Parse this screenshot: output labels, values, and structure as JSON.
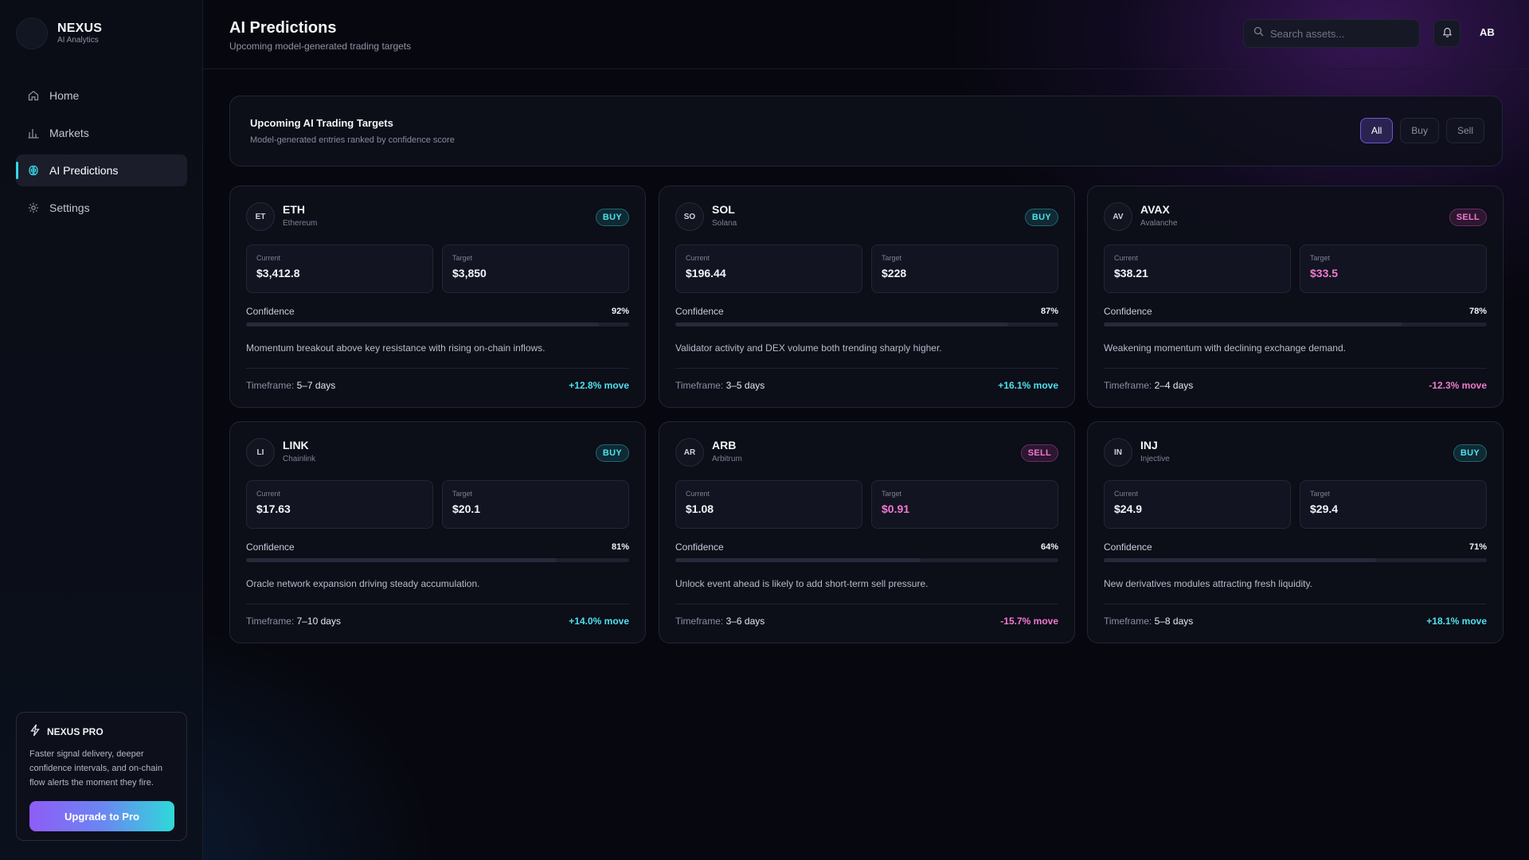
{
  "brand": {
    "name": "NEXUS",
    "subtitle": "AI Analytics"
  },
  "nav": {
    "items": [
      {
        "label": "Home",
        "icon": "home-icon",
        "active": false
      },
      {
        "label": "Markets",
        "icon": "bar-chart-icon",
        "active": false
      },
      {
        "label": "AI Predictions",
        "icon": "brain-icon",
        "active": true
      },
      {
        "label": "Settings",
        "icon": "gear-icon",
        "active": false
      }
    ]
  },
  "pro": {
    "title": "NEXUS PRO",
    "icon": "lightning-icon",
    "description": "Faster signal delivery, deeper confidence intervals, and on-chain flow alerts the moment they fire.",
    "button": "Upgrade to Pro"
  },
  "header": {
    "title": "AI Predictions",
    "subtitle": "Upcoming model-generated trading targets",
    "search_placeholder": "Search assets...",
    "avatar": "AB"
  },
  "panel": {
    "title": "Upcoming AI Trading Targets",
    "subtitle": "Model-generated entries ranked by confidence score",
    "filters": [
      {
        "label": "All",
        "active": true
      },
      {
        "label": "Buy",
        "active": false
      },
      {
        "label": "Sell",
        "active": false
      }
    ]
  },
  "labels": {
    "current": "Current",
    "target": "Target",
    "confidence": "Confidence",
    "timeframe": "Timeframe:"
  },
  "colors": {
    "buy": "#4fe0ef",
    "sell": "#f07ad0",
    "accent_purple": "#8f5cf6",
    "accent_cyan": "#2fd9d9"
  },
  "predictions": [
    {
      "badge": "ET",
      "symbol": "ETH",
      "name": "Ethereum",
      "signal": "BUY",
      "current": "$3,412.8",
      "target": "$3,850",
      "confidence": "92%",
      "confidence_fraction": 0.92,
      "rationale": "Momentum breakout above key resistance with rising on-chain inflows.",
      "timeframe": "5–7 days",
      "move": "+12.8% move"
    },
    {
      "badge": "SO",
      "symbol": "SOL",
      "name": "Solana",
      "signal": "BUY",
      "current": "$196.44",
      "target": "$228",
      "confidence": "87%",
      "confidence_fraction": 0.87,
      "rationale": "Validator activity and DEX volume both trending sharply higher.",
      "timeframe": "3–5 days",
      "move": "+16.1% move"
    },
    {
      "badge": "AV",
      "symbol": "AVAX",
      "name": "Avalanche",
      "signal": "SELL",
      "current": "$38.21",
      "target": "$33.5",
      "confidence": "78%",
      "confidence_fraction": 0.78,
      "rationale": "Weakening momentum with declining exchange demand.",
      "timeframe": "2–4 days",
      "move": "-12.3% move"
    },
    {
      "badge": "LI",
      "symbol": "LINK",
      "name": "Chainlink",
      "signal": "BUY",
      "current": "$17.63",
      "target": "$20.1",
      "confidence": "81%",
      "confidence_fraction": 0.81,
      "rationale": "Oracle network expansion driving steady accumulation.",
      "timeframe": "7–10 days",
      "move": "+14.0% move"
    },
    {
      "badge": "AR",
      "symbol": "ARB",
      "name": "Arbitrum",
      "signal": "SELL",
      "current": "$1.08",
      "target": "$0.91",
      "confidence": "64%",
      "confidence_fraction": 0.64,
      "rationale": "Unlock event ahead is likely to add short-term sell pressure.",
      "timeframe": "3–6 days",
      "move": "-15.7% move"
    },
    {
      "badge": "IN",
      "symbol": "INJ",
      "name": "Injective",
      "signal": "BUY",
      "current": "$24.9",
      "target": "$29.4",
      "confidence": "71%",
      "confidence_fraction": 0.71,
      "rationale": "New derivatives modules attracting fresh liquidity.",
      "timeframe": "5–8 days",
      "move": "+18.1% move"
    }
  ]
}
